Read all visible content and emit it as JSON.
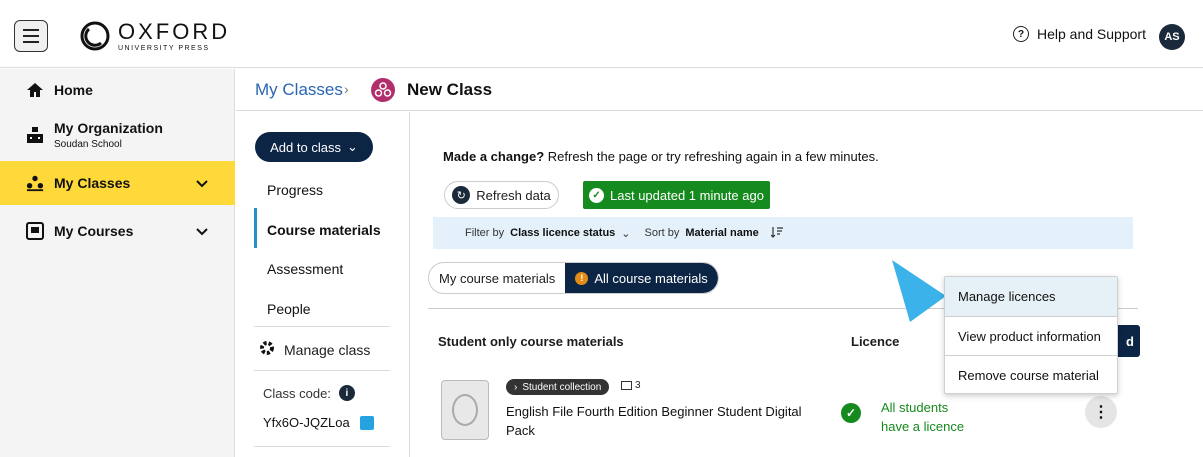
{
  "header": {
    "logo_main": "OXFORD",
    "logo_sub": "UNIVERSITY PRESS",
    "help_label": "Help and Support",
    "avatar_initials": "AS"
  },
  "sidebar": {
    "items": [
      {
        "label": "Home",
        "icon": "home-icon"
      },
      {
        "label": "My Organization",
        "sublabel": "Soudan School",
        "icon": "organization-icon"
      },
      {
        "label": "My Classes",
        "icon": "classes-icon",
        "active": true
      },
      {
        "label": "My Courses",
        "icon": "courses-icon"
      }
    ],
    "active_color": "#ffd83a"
  },
  "breadcrumb": {
    "parent": "My Classes",
    "current": "New Class"
  },
  "subnav": {
    "add_label": "Add to class",
    "items": [
      "Progress",
      "Course materials",
      "Assessment",
      "People"
    ],
    "active": "Course materials",
    "manage_label": "Manage class",
    "class_code_label": "Class code:",
    "class_code": "Yfx6O-JQZLoa"
  },
  "main": {
    "made_change_bold": "Made a change?",
    "made_change_text": "Refresh the page or try refreshing again in a few minutes.",
    "refresh_label": "Refresh data",
    "updated_label": "Last updated 1 minute ago",
    "filter_by": "Filter by",
    "filter_value": "Class licence status",
    "sort_by": "Sort by",
    "sort_value": "Material name",
    "tab_my": "My course materials",
    "tab_all": "All course materials",
    "col_materials": "Student only course materials",
    "col_licence": "Licence",
    "add_partial": "d",
    "row": {
      "badge": "Student collection",
      "count": "3",
      "title": "English File Fourth Edition Beginner Student Digital Pack",
      "licence_line1": "All students",
      "licence_line2": "have a licence"
    }
  },
  "dropdown": {
    "items": [
      "Manage licences",
      "View product information",
      "Remove course material"
    ]
  },
  "colors": {
    "navy": "#0d2545",
    "green": "#158a1e",
    "link_blue": "#2a66b0",
    "arrow_blue": "#3bb3ea"
  }
}
